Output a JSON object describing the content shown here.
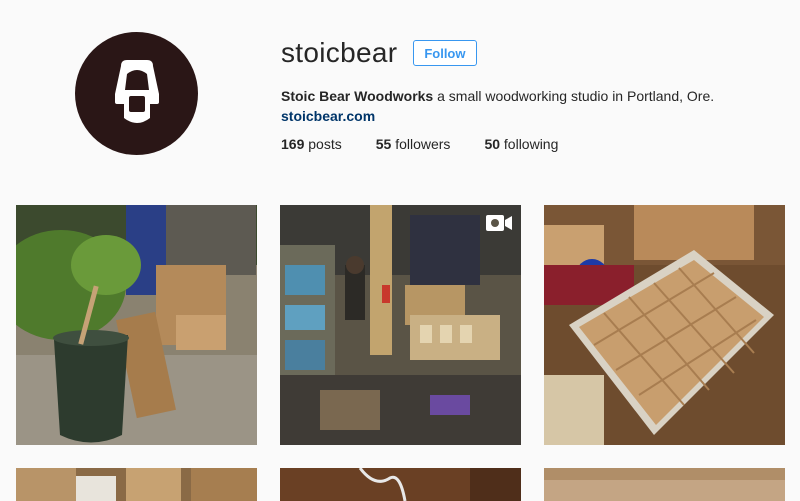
{
  "profile": {
    "username": "stoicbear",
    "follow_label": "Follow",
    "full_name": "Stoic Bear Woodworks",
    "bio_text": " a small woodworking studio in Portland, Ore.",
    "website": "stoicbear.com",
    "avatar_icon": "bear-logo-icon"
  },
  "stats": {
    "posts_count": "169",
    "posts_label": "posts",
    "followers_count": "55",
    "followers_label": "followers",
    "following_count": "50",
    "following_label": "following"
  },
  "posts": [
    {
      "id": "post-1",
      "type": "photo"
    },
    {
      "id": "post-2",
      "type": "video",
      "badge_icon": "video-icon"
    },
    {
      "id": "post-3",
      "type": "photo"
    },
    {
      "id": "post-4",
      "type": "photo"
    },
    {
      "id": "post-5",
      "type": "photo"
    },
    {
      "id": "post-6",
      "type": "photo"
    }
  ],
  "colors": {
    "background": "#fafafa",
    "accent": "#3897f0",
    "link": "#003569",
    "avatar": "#2a1616"
  }
}
